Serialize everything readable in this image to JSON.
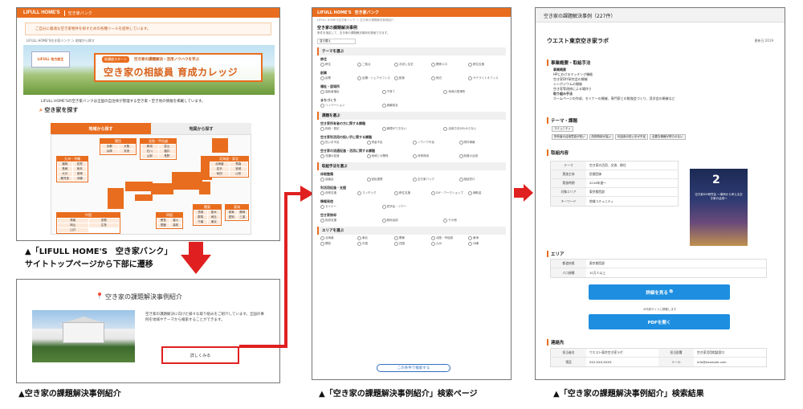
{
  "screen1": {
    "logo": "LIFULL HOME'S",
    "header_title": "空き家バンク",
    "notice": "ご自分に最適な空き家物件を探すための各種ツールを提供しています。",
    "breadcrumb": "LIFULL HOME'S空き家バンク ＞ 地域から探す",
    "banner_logo": "LIFULL 地方創生",
    "banner_tag": "新講座スタート",
    "banner_sub": "空き家の課題解決・活用ノウハウを学ぶ",
    "banner_main": "空き家の相談員 育成カレッジ",
    "intro": "LIFULL HOME'Sの空き家バンクは全国の自治体が管理する空き家・空き地の情報を掲載しています。",
    "search_title": "空き家を探す",
    "tab_region": "地域から探す",
    "tab_map": "地図から探す",
    "regions": [
      {
        "name": "九州・沖縄",
        "prefs": [
          "福岡",
          "佐賀",
          "長崎",
          "熊本",
          "大分",
          "宮崎",
          "鹿児島",
          "沖縄"
        ]
      },
      {
        "name": "中国",
        "prefs": [
          "鳥取",
          "島根",
          "岡山",
          "広島",
          "山口"
        ]
      },
      {
        "name": "関西",
        "prefs": [
          "京都",
          "大阪",
          "兵庫",
          "奈良"
        ]
      },
      {
        "name": "北陸・甲信越",
        "prefs": [
          "新潟",
          "富山",
          "石川",
          "福井",
          "山梨",
          "長野"
        ]
      },
      {
        "name": "北海道・東北",
        "prefs": [
          "北海道",
          "青森",
          "岩手",
          "宮城",
          "秋田",
          "山形"
        ]
      },
      {
        "name": "関東",
        "prefs": [
          "茨城",
          "栃木",
          "群馬",
          "埼玉",
          "千葉",
          "東京"
        ]
      },
      {
        "name": "四国",
        "prefs": [
          "徳島",
          "香川",
          "愛媛",
          "高知"
        ]
      },
      {
        "name": "東海",
        "prefs": [
          "岐阜",
          "静岡",
          "愛知",
          "三重"
        ]
      }
    ]
  },
  "screen2": {
    "title": "空き家の課題解決事例紹介",
    "desc": "空き家の課題解決に向けた様々な取り組みをご紹介しています。全国の事例を地域やテーマから検索することができます。",
    "button": "詳しくみる"
  },
  "screen3": {
    "header_title": "空き家バンク",
    "breadcrumb": "LIFULL HOME'S空き家バンク ＞ 空き家の課題解決事例紹介",
    "page_title": "空き家の課題解決事例",
    "page_desc": "条件を指定して、空き家の課題解決事例を検索できます。",
    "select": "並び替え",
    "sections": [
      {
        "title": "テーマを選ぶ",
        "groups": [
          {
            "name": "移住",
            "options": [
              "移住",
              "二拠点",
              "お試し住宅",
              "関係人口",
              "移住支援"
            ]
          },
          {
            "name": "創業",
            "options": [
              "起業",
              "店舗・シェアオフィス",
              "飲食",
              "宿泊",
              "サテライトオフィス"
            ]
          },
          {
            "name": "福祉・居場所",
            "options": [
              "高齢者福祉",
              "子育て",
              "地域の居場所"
            ]
          },
          {
            "name": "まちづくり",
            "options": [
              "リノベーション",
              "景観保全"
            ]
          }
        ]
      },
      {
        "title": "課題を選ぶ",
        "groups": [
          {
            "name": "空き家所有者の方に関する課題",
            "options": [
              "相続・登記",
              "管理ができない",
              "活用方法がわからない"
            ]
          },
          {
            "name": "空き家利活用の担い手に関する課題",
            "options": [
              "担い手不足",
              "資金不足",
              "ノウハウ不足",
              "物件情報"
            ]
          },
          {
            "name": "空き家の流通促進・活用に関する課題",
            "options": [
              "流通の促進",
              "地域との関係",
              "改修費用",
              "制度の活用"
            ]
          }
        ]
      },
      {
        "title": "取組手法を選ぶ",
        "groups": [
          {
            "name": "体制整備",
            "options": [
              "協議会",
              "官民連携",
              "空き家バンク",
              "相談窓口"
            ]
          },
          {
            "name": "利活用促進・支援",
            "options": [
              "改修支援",
              "マッチング",
              "移住支援",
              "DIY・ワークショップ",
              "補助金"
            ]
          },
          {
            "name": "情報発信",
            "options": [
              "セミナー",
              "見学会・ツアー"
            ]
          },
          {
            "name": "空き家除却",
            "options": [
              "除却支援",
              "跡地活用",
              "その他"
            ]
          }
        ]
      },
      {
        "title": "エリアを選ぶ",
        "groups": [
          {
            "name": "",
            "options": [
              "北海道",
              "東北",
              "関東",
              "北陸・甲信越",
              "東海",
              "関西",
              "中国",
              "四国",
              "九州",
              "沖縄"
            ]
          }
        ]
      }
    ],
    "search_button": "この条件で検索する"
  },
  "screen4": {
    "top_title": "空き家の課題解決事例（227件）",
    "name": "ウエスト東京空き家ラボ",
    "date": "更新日:2019",
    "sec_summary": "事業概要・取組手法",
    "summary_lines": [
      "事業概要",
      "HPにおけるマッチング機能",
      "空き家DIY研究会の開催",
      "シンポジウムの開催",
      "空き家等改修による場作り",
      "取り組み手法",
      "ホームページの作成、セミナーの開催、専門家との勉強会づくり、見学会の開催など"
    ],
    "sec_theme": "テーマ・課題",
    "theme_chips": [
      "コミュニティ"
    ],
    "issue_chips": [
      "所有者の活用意欲が低い",
      "改修費用が高い",
      "利活用の担い手が不足",
      "必要な情報が得られない"
    ],
    "sec_detail": "取組内容",
    "detail_rows": [
      {
        "k": "テーマ",
        "v": "空き家の活用、交流、移住"
      },
      {
        "k": "実施主体",
        "v": "民間団体"
      },
      {
        "k": "実施時期",
        "v": "2016年度〜"
      },
      {
        "k": "対象エリア",
        "v": "東京都西部"
      },
      {
        "k": "キーワード",
        "v": "地域コミュニティ"
      }
    ],
    "poster_num": "2",
    "poster_text": "空き家DIY研究会 〜事例から考える空き家の活用〜",
    "sec_area": "エリア",
    "area_rows": [
      {
        "k": "都道府県",
        "v": "東京都西部"
      },
      {
        "k": "人口規模",
        "v": "10万人以上"
      }
    ],
    "btn_detail": "詳細を見る",
    "btn_pdf": "PDFを開く",
    "subnote": "※外部サイトに移動します",
    "sec_contact": "連絡先",
    "contact_rows": [
      {
        "k": "担当者名",
        "v": "ウエスト東京空き家ラボ",
        "k2": "担当部署",
        "v2": "空き家活用相談窓口"
      },
      {
        "k": "電話",
        "v": "042-XXX-XXXX",
        "k2": "メール",
        "v2": "info@example.com"
      }
    ]
  },
  "captions": {
    "c1a": "▲「LIFULL HOME'S　空き家バンク」",
    "c1b": "サイトトップページから下部に遷移",
    "c2": "▲空き家の課題解決事例紹介",
    "c3": "▲「空き家の課題解決事例紹介」検索ページ",
    "c4": "▲「空き家の課題解決事例紹介」検索結果"
  },
  "colors": {
    "accent": "#e96d1e",
    "arrow": "#e02020",
    "button_blue": "#1e8fe0"
  }
}
